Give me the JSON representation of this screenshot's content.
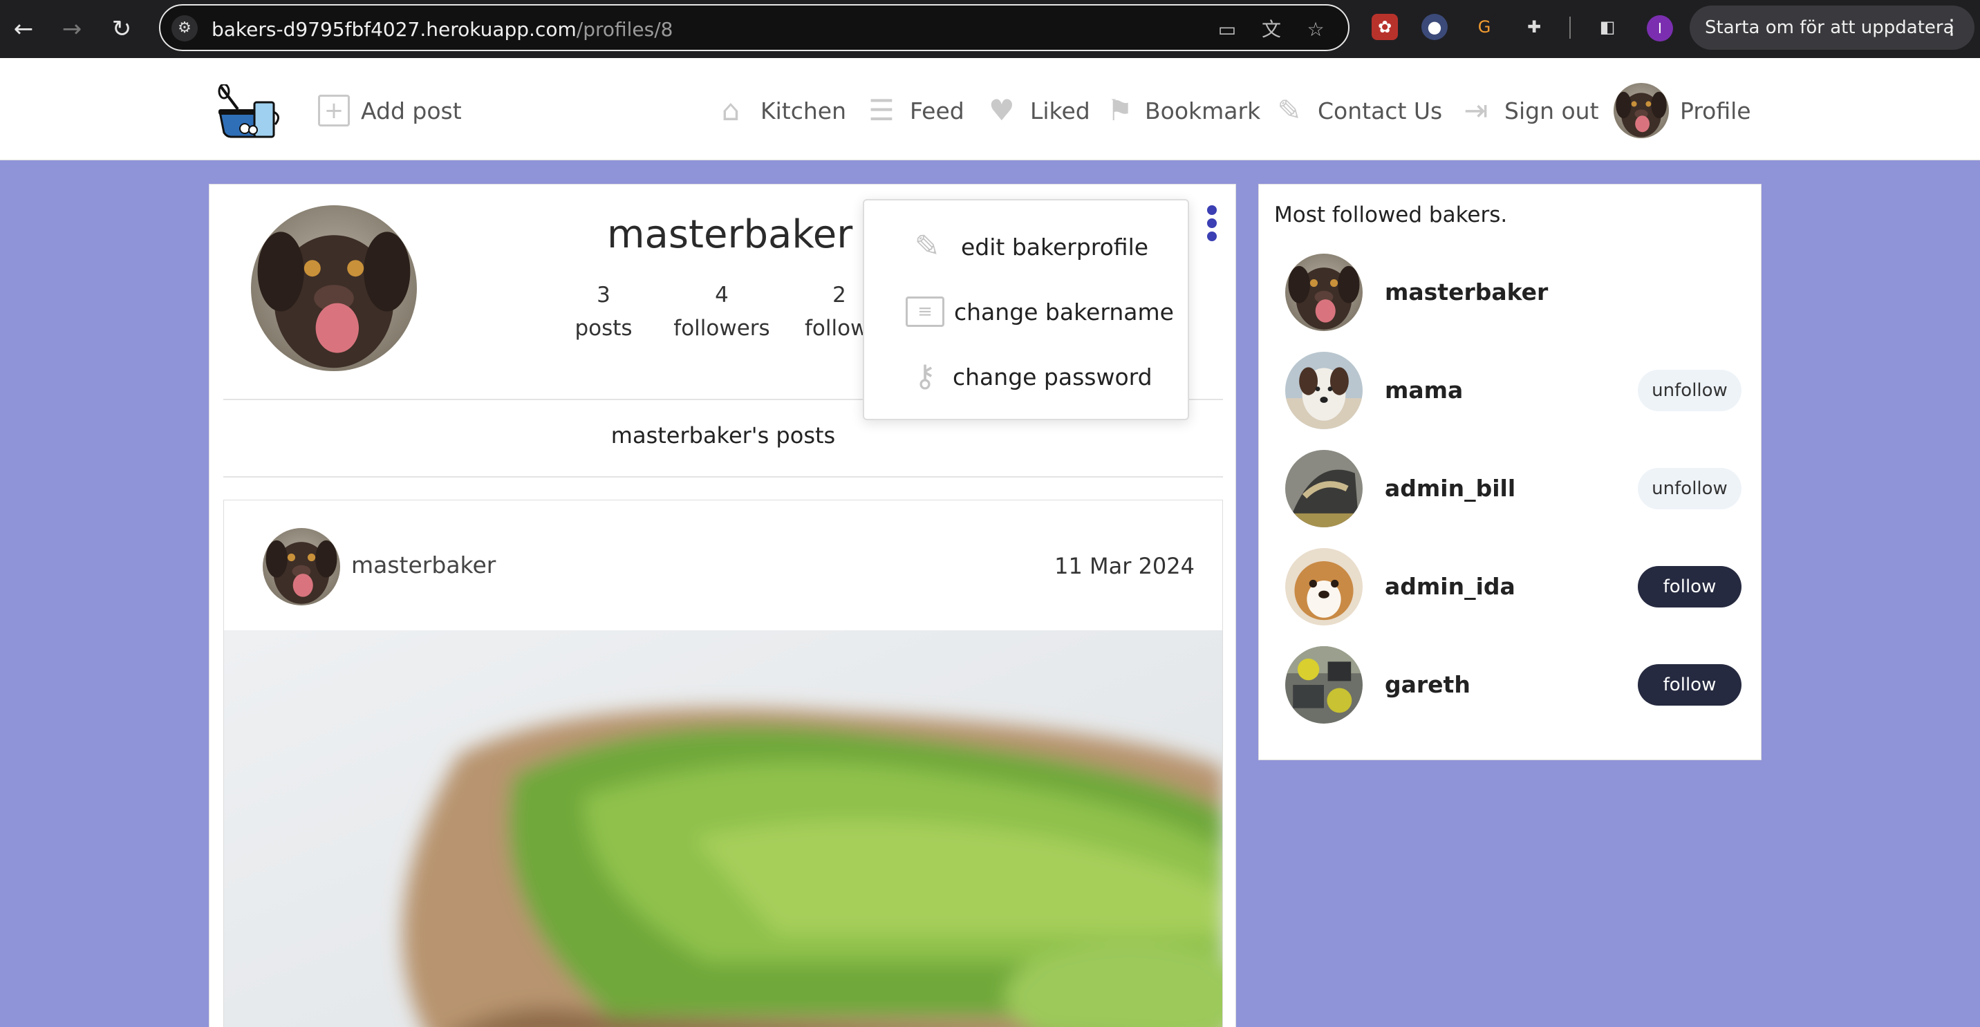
{
  "browser": {
    "url_host": "bakers-d9795fbf4027.herokuapp.com",
    "url_path": "/profiles/8",
    "profile_initial": "I",
    "update_label": "Starta om för att uppdatera",
    "icons": [
      "back-icon",
      "forward-icon",
      "reload-icon",
      "site-settings-icon",
      "install-app-icon",
      "translate-icon",
      "bookmark-star-icon",
      "extensions-icon",
      "side-panel-icon",
      "menu-icon"
    ]
  },
  "header": {
    "add_post": "Add post",
    "nav": [
      {
        "label": "Kitchen",
        "icon": "home-icon"
      },
      {
        "label": "Feed",
        "icon": "feed-icon"
      },
      {
        "label": "Liked",
        "icon": "heart-icon"
      },
      {
        "label": "Bookmark",
        "icon": "bookmark-icon"
      },
      {
        "label": "Contact Us",
        "icon": "pencil-icon"
      },
      {
        "label": "Sign out",
        "icon": "sign-out-icon"
      },
      {
        "label": "Profile",
        "icon": "avatar"
      }
    ]
  },
  "profile": {
    "name": "masterbaker",
    "stats": [
      {
        "value": "3",
        "label": "posts"
      },
      {
        "value": "4",
        "label": "followers"
      },
      {
        "value": "2",
        "label": "followi"
      }
    ],
    "posts_heading": "masterbaker's posts"
  },
  "menu": {
    "items": [
      {
        "label": "edit bakerprofile",
        "icon": "edit-icon"
      },
      {
        "label": "change bakername",
        "icon": "id-card-icon"
      },
      {
        "label": "change password",
        "icon": "key-icon"
      }
    ]
  },
  "post": {
    "author": "masterbaker",
    "date": "11 Mar 2024"
  },
  "sidebar": {
    "title": "Most followed bakers.",
    "bakers": [
      {
        "name": "masterbaker",
        "button": ""
      },
      {
        "name": "mama",
        "button": "unfollow"
      },
      {
        "name": "admin_bill",
        "button": "unfollow"
      },
      {
        "name": "admin_ida",
        "button": "follow"
      },
      {
        "name": "gareth",
        "button": "follow"
      }
    ]
  },
  "colors": {
    "page_background": "#8f93d8",
    "accent": "#3b3fb3",
    "follow_button": "#262a40",
    "unfollow_button": "#eef3f8"
  }
}
